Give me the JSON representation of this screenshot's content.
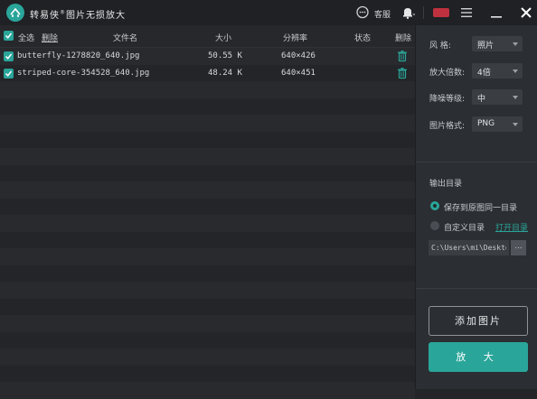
{
  "app": {
    "title": "转易侠",
    "title_suffix": "图片无损放大",
    "brand_mark": "®"
  },
  "titlebar": {
    "kefu_label": "客服"
  },
  "table": {
    "select_all_label": "全选",
    "delete_link": "删除",
    "columns": {
      "filename": "文件名",
      "size": "大小",
      "resolution": "分辨率",
      "status": "状态",
      "delete": "删除"
    },
    "rows": [
      {
        "filename": "butterfly-1278820_640.jpg",
        "size": "50.55 K",
        "resolution": "640×426",
        "status": ""
      },
      {
        "filename": "striped-core-354528_640.jpg",
        "size": "48.24 K",
        "resolution": "640×451",
        "status": ""
      }
    ]
  },
  "options": {
    "style_label": "风    格:",
    "style_value": "照片",
    "scale_label": "放大倍数:",
    "scale_value": "4倍",
    "denoise_label": "降噪等级:",
    "denoise_value": "中",
    "format_label": "图片格式:",
    "format_value": "PNG"
  },
  "output": {
    "title": "输出目录",
    "same_dir_label": "保存到原图同一目录",
    "custom_dir_label": "自定义目录",
    "open_dir_link": "打开目录",
    "path_value": "C:\\Users\\mi\\Desktop",
    "browse_label": "..."
  },
  "actions": {
    "add_label": "添加图片",
    "zoom_label": "放 大"
  },
  "colors": {
    "accent": "#2aa59a",
    "background": "#232528",
    "panel": "#2b2e32",
    "badge": "#c0313f"
  }
}
